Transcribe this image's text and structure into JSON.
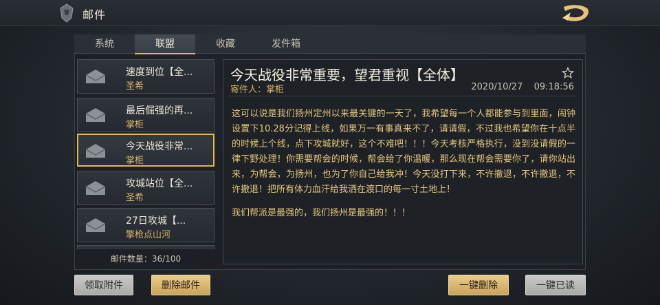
{
  "header": {
    "title": "邮件"
  },
  "tabs": [
    {
      "label": "系统",
      "active": false
    },
    {
      "label": "联盟",
      "active": true
    },
    {
      "label": "收藏",
      "active": false
    },
    {
      "label": "发件箱",
      "active": false
    }
  ],
  "mails": [
    {
      "title": "速度到位【全...",
      "sender": "圣希",
      "selected": false
    },
    {
      "title": "最后倔强的再...",
      "sender": "掌柜",
      "selected": false
    },
    {
      "title": "今天战役非常...",
      "sender": "掌柜",
      "selected": true
    },
    {
      "title": "攻城站位【全...",
      "sender": "圣希",
      "selected": false
    },
    {
      "title": "27日攻城【...",
      "sender": "擎枪点山河",
      "selected": false
    }
  ],
  "mail_count": "邮件数量：36/100",
  "detail": {
    "title": "今天战役非常重要，望君重视【全体】",
    "sender": "寄件人：掌柜",
    "date": "2020/10/27",
    "time": "09:18:56",
    "paragraphs": [
      "这可以说是我们扬州定州以来最关键的一天了，我希望每一个人都能参与到里面，闹钟设置下10.28分记得上线，如果万一有事真来不了，请请假，不过我也希望你在十点半的时候上个线，点下攻城就好，这个不难吧！！！今天考核严格执行，没到没请假的一律下野处理！你需要帮会的时候，帮会给了你温暖，那么现在帮会需要你了，请你站出来，为帮会，为扬州，也为了你自己给我冲！今天没打下来，不许撤退，不许撤退，不许撤退！把所有体力血汗给我洒在渡口的每一寸土地上！",
      "我们帮派是最强的，我们扬州是最强的！！！"
    ]
  },
  "buttons": {
    "claim_attachments": "领取附件",
    "delete_mail": "删除邮件",
    "delete_all": "一键删除",
    "read_all": "一键已读"
  },
  "colors": {
    "accent_gold": "#e0b84c",
    "body_text": "#e6c77c",
    "sender_gold": "#d9b66a"
  },
  "icons": {
    "back": "helmet-emblem-icon",
    "logo": "dragon-logo-icon",
    "mail": "envelope-icon",
    "favorite": "star-outline-icon"
  }
}
